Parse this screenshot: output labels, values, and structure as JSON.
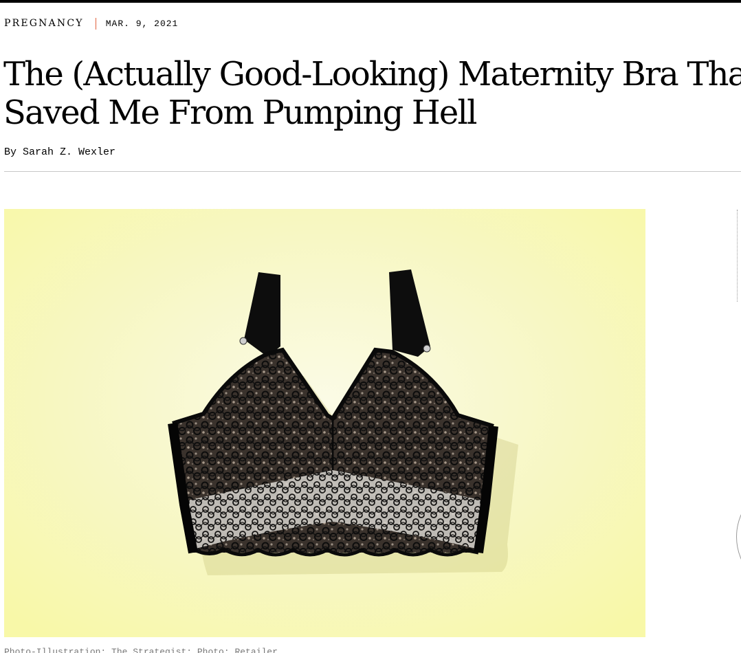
{
  "article": {
    "category": "PREGNANCY",
    "date": "MAR. 9, 2021",
    "headline_line1": "The (Actually Good-Looking) Maternity Bra That",
    "headline_line2": "Saved Me From Pumping Hell",
    "byline_prefix": "By",
    "byline_author": "Sarah Z. Wexler"
  },
  "hero": {
    "background_color": "#f8f8b8",
    "subject": "black lace maternity bralette",
    "caption": "Photo-Illustration: The Strategist; Photo: Retailer"
  },
  "colors": {
    "accent_divider": "#e0603c",
    "text": "#000000",
    "rule": "#c8c8c8"
  }
}
